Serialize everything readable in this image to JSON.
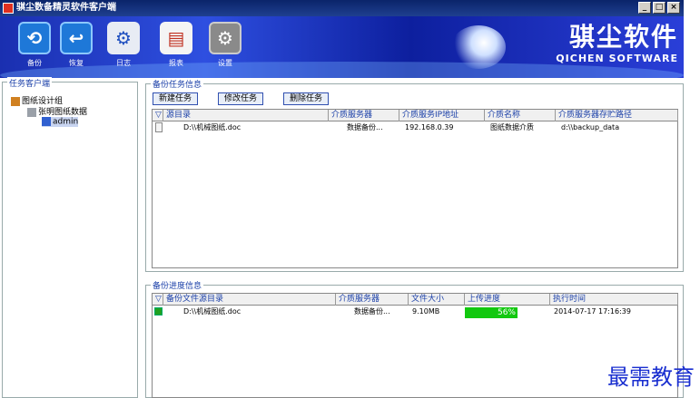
{
  "window": {
    "title": "骐尘数备精灵软件客户端",
    "controls": [
      "_",
      "□",
      "×"
    ]
  },
  "toolbar": {
    "buttons": [
      {
        "label": "备份",
        "icon": "backup-icon"
      },
      {
        "label": "恢复",
        "icon": "restore-icon"
      },
      {
        "label": "日志",
        "icon": "log-icon"
      },
      {
        "label": "报表",
        "icon": "report-icon"
      },
      {
        "label": "设置",
        "icon": "settings-icon"
      }
    ],
    "brand_cn": "骐尘软件",
    "brand_en": "QICHEN SOFTWARE"
  },
  "left_panel": {
    "title": "任务客户端",
    "tree": [
      {
        "label": "图纸设计组"
      },
      {
        "label": "张明图纸数据"
      },
      {
        "label": "admin"
      }
    ]
  },
  "tasks": {
    "title": "备份任务信息",
    "buttons": {
      "new": "新建任务",
      "edit": "修改任务",
      "delete": "删除任务"
    },
    "columns": [
      "源目录",
      "介质服务器",
      "介质服务IP地址",
      "介质名称",
      "介质服务器存贮路径"
    ],
    "rows": [
      [
        "D:\\\\机械图纸.doc",
        "数据备份...",
        "192.168.0.39",
        "图纸数据介质",
        "d:\\\\backup_data"
      ]
    ]
  },
  "progress": {
    "title": "备份进度信息",
    "columns": [
      "备份文件源目录",
      "介质服务器",
      "文件大小",
      "上传进度",
      "执行时间"
    ],
    "rows": [
      {
        "source": "D:\\\\机械图纸.doc",
        "server": "数据备份...",
        "size": "9.10MB",
        "progress": "56%",
        "progress_value": 56,
        "time": "2014-07-17 17:16:39"
      }
    ]
  },
  "watermark": "最需教育"
}
